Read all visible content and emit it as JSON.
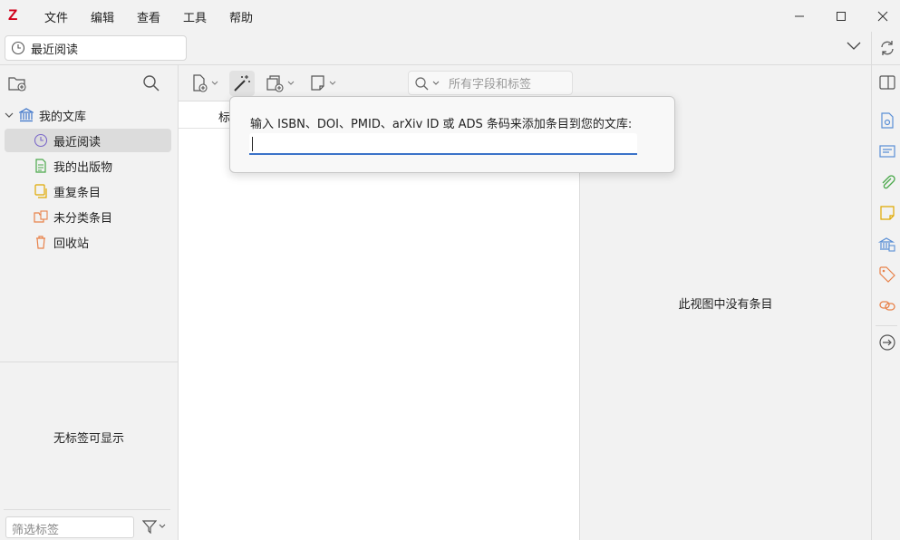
{
  "app": {
    "logo": "Z"
  },
  "menu": [
    "文件",
    "编辑",
    "查看",
    "工具",
    "帮助"
  ],
  "tab": {
    "label": "最近阅读"
  },
  "collections": {
    "library": "我的文库",
    "items": [
      "最近阅读",
      "我的出版物",
      "重复条目",
      "未分类条目",
      "回收站"
    ]
  },
  "tags": {
    "empty": "无标签可显示",
    "filter_placeholder": "筛选标签"
  },
  "toolbar": {
    "search_placeholder": "所有字段和标签"
  },
  "items_table": {
    "title_column": "标"
  },
  "item_pane": {
    "empty": "此视图中没有条目"
  },
  "add_by_identifier": {
    "label": "输入 ISBN、DOI、PMID、arXiv ID 或 ADS 条码来添加条目到您的文库:",
    "value": ""
  },
  "colors": {
    "accent": "#3b73c9",
    "logo": "#d0021b",
    "selected": "#dcdcdc"
  }
}
